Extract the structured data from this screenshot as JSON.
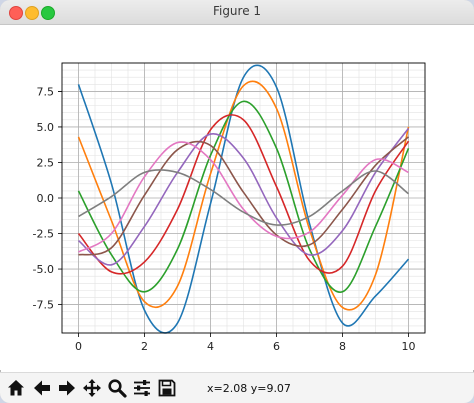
{
  "window": {
    "title": "Figure 1"
  },
  "toolbar": {
    "buttons": [
      {
        "name": "home-button",
        "icon": "home-icon"
      },
      {
        "name": "back-button",
        "icon": "arrow-left-icon"
      },
      {
        "name": "forward-button",
        "icon": "arrow-right-icon"
      },
      {
        "name": "pan-button",
        "icon": "move-icon"
      },
      {
        "name": "zoom-button",
        "icon": "magnifier-icon"
      },
      {
        "name": "configure-subplots-button",
        "icon": "sliders-icon"
      },
      {
        "name": "save-button",
        "icon": "floppy-disk-icon"
      }
    ],
    "coords": "x=2.08 y=9.07"
  },
  "chart_data": {
    "type": "line",
    "title": "",
    "xlabel": "",
    "ylabel": "",
    "xlim": [
      -0.5,
      10.5
    ],
    "ylim": [
      -9.5,
      9.5
    ],
    "x_ticks": [
      "0",
      "2",
      "4",
      "6",
      "8",
      "10"
    ],
    "y_ticks": [
      "-7.5",
      "-5.0",
      "-2.5",
      "0.0",
      "2.5",
      "5.0",
      "7.5"
    ],
    "grid": "major and minor",
    "x_sample": [
      0,
      1,
      2,
      3,
      4,
      5,
      6,
      7,
      8,
      9,
      10
    ],
    "series": [
      {
        "color": "#1f77b4",
        "values": [
          8.0,
          1.0,
          -7.9,
          -8.8,
          -0.4,
          8.5,
          7.8,
          -1.8,
          -8.8,
          -6.9,
          -4.3
        ]
      },
      {
        "color": "#ff7f0e",
        "values": [
          4.3,
          -1.6,
          -7.3,
          -6.2,
          1.7,
          7.9,
          6.3,
          -2.2,
          -7.7,
          -5.4,
          5.0
        ]
      },
      {
        "color": "#2ca02c",
        "values": [
          0.5,
          -4.0,
          -6.6,
          -3.6,
          3.0,
          6.8,
          3.5,
          -3.6,
          -6.6,
          -2.0,
          3.5
        ]
      },
      {
        "color": "#d62728",
        "values": [
          -2.5,
          -5.2,
          -4.5,
          -0.8,
          4.8,
          5.5,
          0.8,
          -4.4,
          -4.8,
          0.5,
          4.0
        ]
      },
      {
        "color": "#9467bd",
        "values": [
          -3.0,
          -4.7,
          -2.0,
          1.8,
          4.5,
          2.8,
          -1.4,
          -4.0,
          -2.3,
          1.8,
          4.9
        ]
      },
      {
        "color": "#8c564b",
        "values": [
          -4.0,
          -3.5,
          0.2,
          3.4,
          3.7,
          0.4,
          -2.6,
          -3.3,
          -0.8,
          2.3,
          4.3
        ]
      },
      {
        "color": "#e377c2",
        "values": [
          -3.8,
          -2.5,
          1.5,
          3.9,
          2.7,
          -0.8,
          -2.7,
          -2.4,
          0.2,
          2.7,
          1.8
        ]
      },
      {
        "color": "#7f7f7f",
        "values": [
          -1.3,
          0.1,
          1.8,
          1.8,
          0.6,
          -1.0,
          -1.9,
          -1.3,
          0.5,
          1.9,
          0.3
        ]
      }
    ]
  }
}
